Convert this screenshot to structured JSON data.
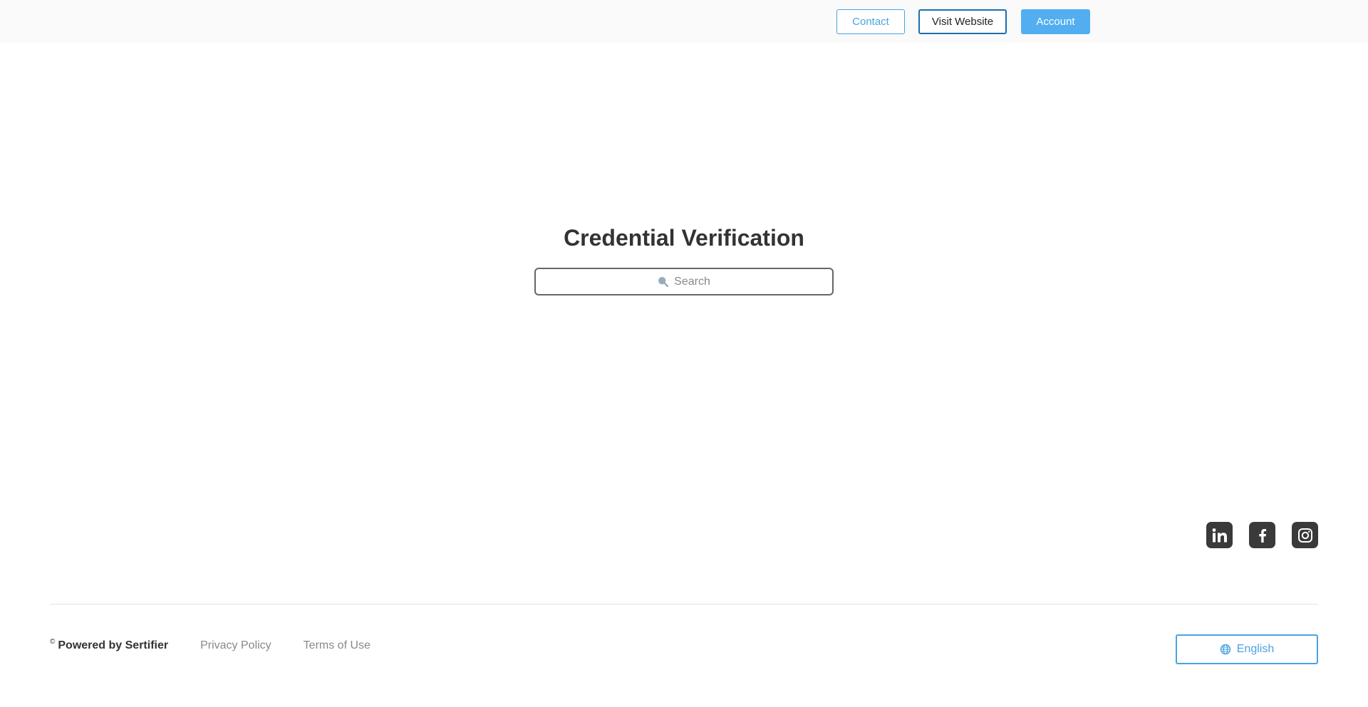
{
  "header": {
    "contact_label": "Contact",
    "visit_website_label": "Visit Website",
    "account_label": "Account"
  },
  "main": {
    "title": "Credential Verification",
    "search_placeholder": "Search",
    "search_value": ""
  },
  "socials": [
    {
      "name": "linkedin",
      "icon": "linkedin-icon"
    },
    {
      "name": "facebook",
      "icon": "facebook-icon"
    },
    {
      "name": "instagram",
      "icon": "instagram-icon"
    }
  ],
  "footer": {
    "copyright_symbol": "©",
    "powered_by": "Powered by Sertifier",
    "privacy_policy": "Privacy Policy",
    "terms_of_use": "Terms of Use",
    "language": "English"
  },
  "colors": {
    "accent": "#4aa3df",
    "account_button": "#52aef0",
    "visit_border": "#1a6fb0",
    "title": "#333333",
    "social_bg": "#3a3a3a"
  }
}
